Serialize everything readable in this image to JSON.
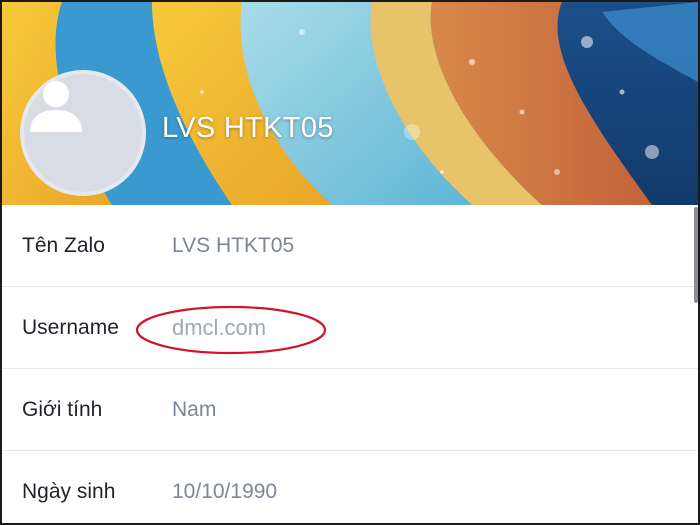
{
  "profile": {
    "display_name": "LVS HTKT05",
    "avatar_icon": "user-silhouette-icon"
  },
  "info_rows": [
    {
      "label": "Tên Zalo",
      "value": "LVS HTKT05"
    },
    {
      "label": "Username",
      "value": "dmcl.com"
    },
    {
      "label": "Giới tính",
      "value": "Nam"
    },
    {
      "label": "Ngày sinh",
      "value": "10/10/1990"
    }
  ],
  "colors": {
    "annotation_ellipse": "#d0142c",
    "label_text": "#1f2329",
    "value_text": "#7b8794"
  }
}
